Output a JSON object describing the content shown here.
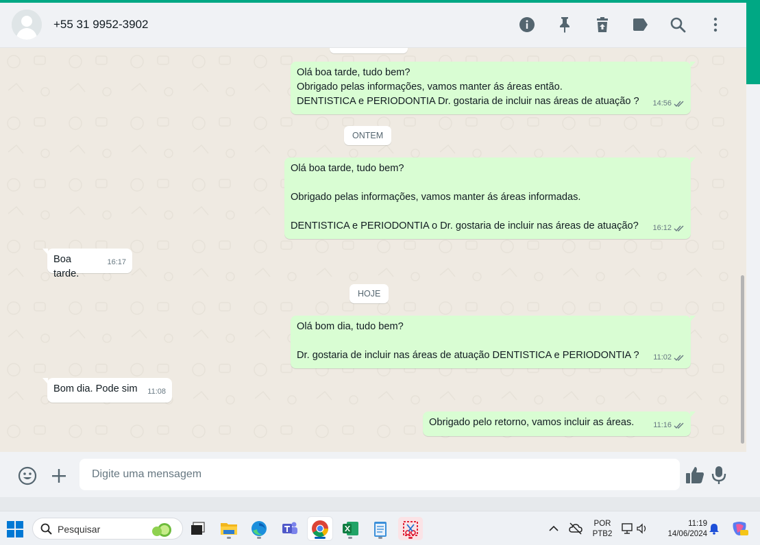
{
  "header": {
    "contact_name": "+55 31 9952-3902",
    "actions": [
      "info-icon",
      "pin-icon",
      "delete-icon",
      "label-icon",
      "search-icon",
      "menu-icon"
    ]
  },
  "messages": [
    {
      "direction": "out",
      "text": "Olá boa tarde, tudo bem?\nObrigado pelas informações, vamos manter ás áreas então.\nDENTISTICA e PERIODONTIA Dr. gostaria de incluir nas áreas de atuação ?",
      "time": "14:56",
      "read": true
    },
    {
      "direction": "out",
      "text": "Olá boa tarde, tudo bem?\n\nObrigado pelas informações, vamos manter ás áreas informadas.\n\nDENTISTICA e PERIODONTIA o Dr. gostaria de incluir nas áreas de atuação?",
      "time": "16:12",
      "read": true
    },
    {
      "direction": "in",
      "text": "Boa tarde.",
      "time": "16:17"
    },
    {
      "direction": "out",
      "text": "Olá bom dia, tudo bem?\n\nDr. gostaria de incluir nas áreas de atuação DENTISTICA e PERIODONTIA ?",
      "time": "11:02",
      "read": true
    },
    {
      "direction": "in",
      "text": "Bom dia. Pode sim",
      "time": "11:08"
    },
    {
      "direction": "out",
      "text": "Obrigado pelo retorno, vamos incluir as áreas.",
      "time": "11:16",
      "read": true
    }
  ],
  "date_chips": {
    "yesterday": "ONTEM",
    "today": "HOJE"
  },
  "composer": {
    "placeholder": "Digite uma mensagem"
  },
  "taskbar": {
    "search_label": "Pesquisar",
    "apps": [
      "task-view",
      "file-explorer",
      "edge",
      "teams",
      "chrome",
      "excel",
      "notepad",
      "snipping-tool"
    ],
    "active_app": "chrome",
    "lang_top": "POR",
    "lang_bottom": "PTB2",
    "time": "11:19",
    "date": "14/06/2024"
  },
  "colors": {
    "accent": "#00a884",
    "outgoing_bubble": "#d9fdd3",
    "incoming_bubble": "#ffffff",
    "chat_bg": "#efeae2",
    "read_tick": "#667781"
  }
}
